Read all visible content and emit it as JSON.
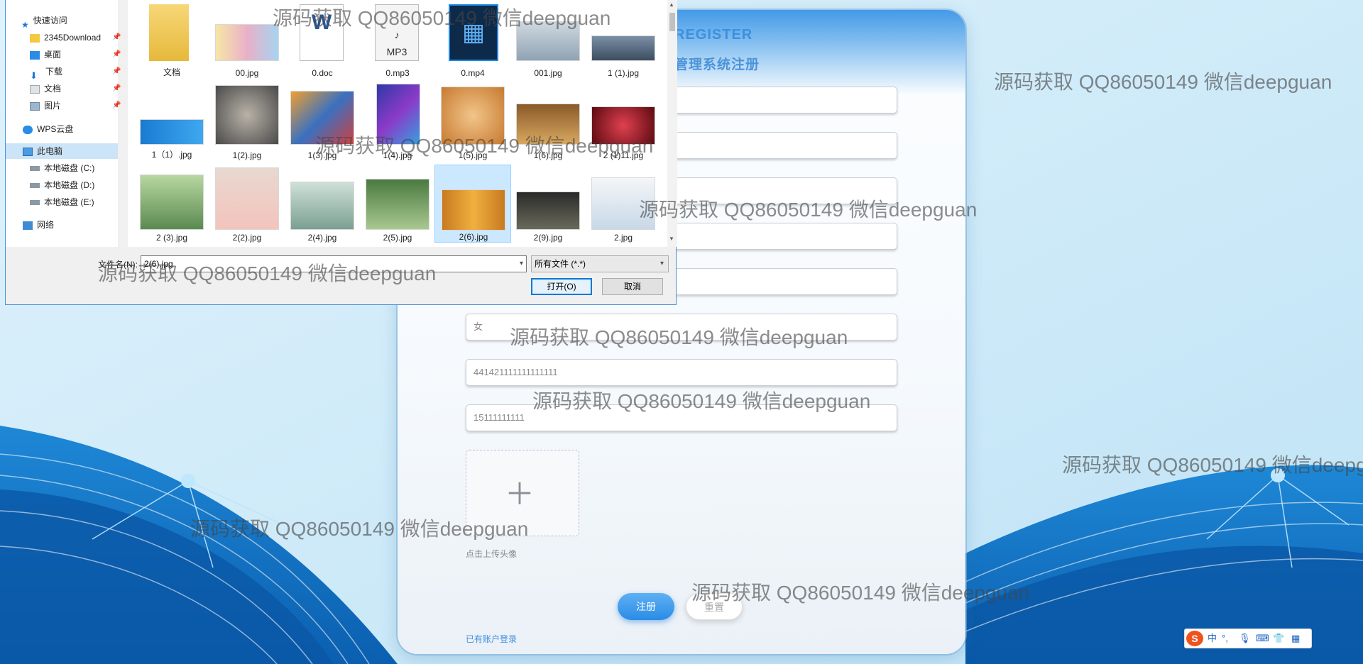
{
  "register": {
    "title": "REGISTER",
    "subtitle": "管理系统注册",
    "gender_value": "女",
    "id_card_value": "441421111111111111",
    "phone_value": "15111111111",
    "upload_hint": "点击上传头像",
    "register_label": "注册",
    "reset_label": "重置",
    "login_link": "已有账户登录"
  },
  "dialog": {
    "nav": {
      "quick_access": "快速访问",
      "items": [
        "2345Download",
        "桌面",
        "下载",
        "文档",
        "图片"
      ],
      "wps": "WPS云盘",
      "this_pc": "此电脑",
      "drives": [
        "本地磁盘 (C:)",
        "本地磁盘 (D:)",
        "本地磁盘 (E:)"
      ],
      "network": "网络"
    },
    "files": [
      "文档",
      "00.jpg",
      "0.doc",
      "0.mp3",
      "0.mp4",
      "001.jpg",
      "1 (1).jpg",
      "1（1）.jpg",
      "1(2).jpg",
      "1(3).jpg",
      "1(4).jpg",
      "1(5).jpg",
      "1(6).jpg",
      "2 (1)11.jpg",
      "2 (3).jpg",
      "2(2).jpg",
      "2(4).jpg",
      "2(5).jpg",
      "2(6).jpg",
      "2(9).jpg",
      "2.jpg"
    ],
    "selected_file": "2(6).jpg",
    "filename_label": "文件名(N):",
    "filename_value": "2(6).jpg",
    "filetype_value": "所有文件 (*.*)",
    "open_label": "打开(O)",
    "cancel_label": "取消"
  },
  "watermark_text": "源码获取 QQ86050149 微信deepguan",
  "ime": {
    "logo": "S",
    "mode": "中"
  },
  "colors": {
    "accent": "#2a8ce6",
    "dialog_border": "#4a8ed8",
    "selection": "#cce8ff"
  }
}
